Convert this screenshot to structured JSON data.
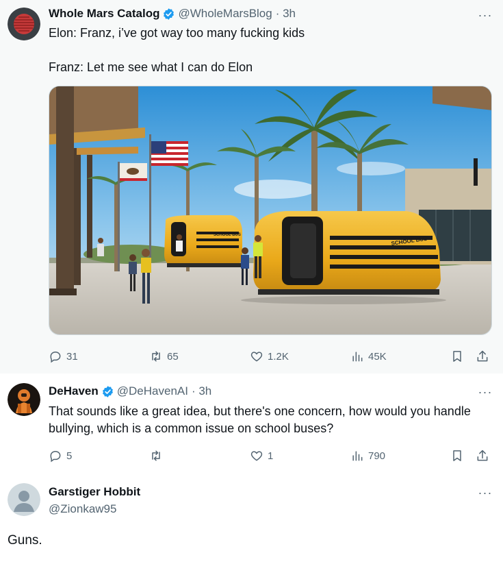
{
  "tweets": [
    {
      "name": "Whole Mars Catalog",
      "handle": "@WholeMarsBlog",
      "time": "· 3h",
      "text": "Elon: Franz, i’ve got way too many fucking kids\n\nFranz: Let me see what I can do Elon",
      "media_icons": [
        "school-bus-graphic",
        "flag-graphic",
        "palm-tree-graphic"
      ],
      "media_labels": [
        "SCHOOL BUS",
        "SCHOOL BUS"
      ],
      "stats": {
        "replies": "31",
        "retweets": "65",
        "likes": "1.2K",
        "views": "45K"
      }
    },
    {
      "name": "DeHaven",
      "handle": "@DeHavenAI",
      "time": "· 3h",
      "text": "That sounds like a great idea, but there's one concern, how would you handle bullying, which is a common issue on school buses?",
      "stats": {
        "replies": "5",
        "retweets": "",
        "likes": "1",
        "views": "790"
      }
    },
    {
      "name": "Garstiger Hobbit",
      "handle": "@Zionkaw95",
      "text": "Guns."
    }
  ],
  "more_glyph": "···",
  "colors": {
    "accent": "#1d9bf0",
    "muted": "#536471",
    "bus": "#f2b21d"
  }
}
